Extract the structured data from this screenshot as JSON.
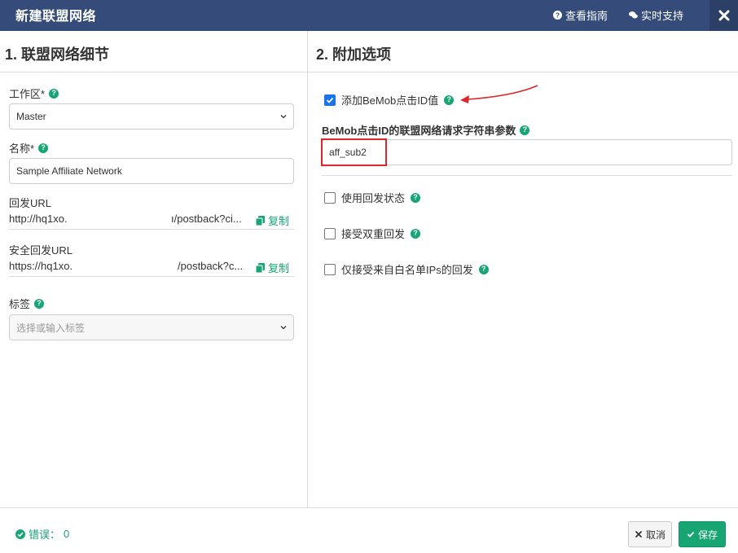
{
  "header": {
    "title": "新建联盟网络",
    "guide_label": "查看指南",
    "support_label": "实时支持",
    "bg_color": "#354b79"
  },
  "left": {
    "section_title": "1. 联盟网络细节",
    "workspace": {
      "label": "工作区*",
      "value": "Master"
    },
    "name": {
      "label": "名称*",
      "value": "Sample Affiliate Network"
    },
    "postback_url": {
      "label": "回发URL",
      "value_start": "http://hq1xo.",
      "value_end": "ı/postback?ci...",
      "copy_label": "复制"
    },
    "secure_postback_url": {
      "label": "安全回发URL",
      "value_start": "https://hq1xo.",
      "value_end": "/postback?c...",
      "copy_label": "复制"
    },
    "tags": {
      "label": "标签",
      "placeholder": "选择或输入标签"
    }
  },
  "right": {
    "section_title": "2. 附加选项",
    "add_click_id": {
      "label": "添加BeMob点击ID值",
      "checked": true
    },
    "click_id_param": {
      "label": "BeMob点击ID的联盟网络请求字符串参数",
      "value": "aff_sub2"
    },
    "use_postback_status": {
      "label": "使用回发状态",
      "checked": false
    },
    "accept_duplicate": {
      "label": "接受双重回发",
      "checked": false
    },
    "whitelist_only": {
      "label": "仅接受来自白名单IPs的回发",
      "checked": false
    }
  },
  "footer": {
    "status_label": "错误：",
    "error_count": "0",
    "cancel_label": "取消",
    "save_label": "保存"
  },
  "colors": {
    "accent": "#17a673",
    "checkbox": "#1a73e8",
    "highlight": "#e0262b"
  }
}
